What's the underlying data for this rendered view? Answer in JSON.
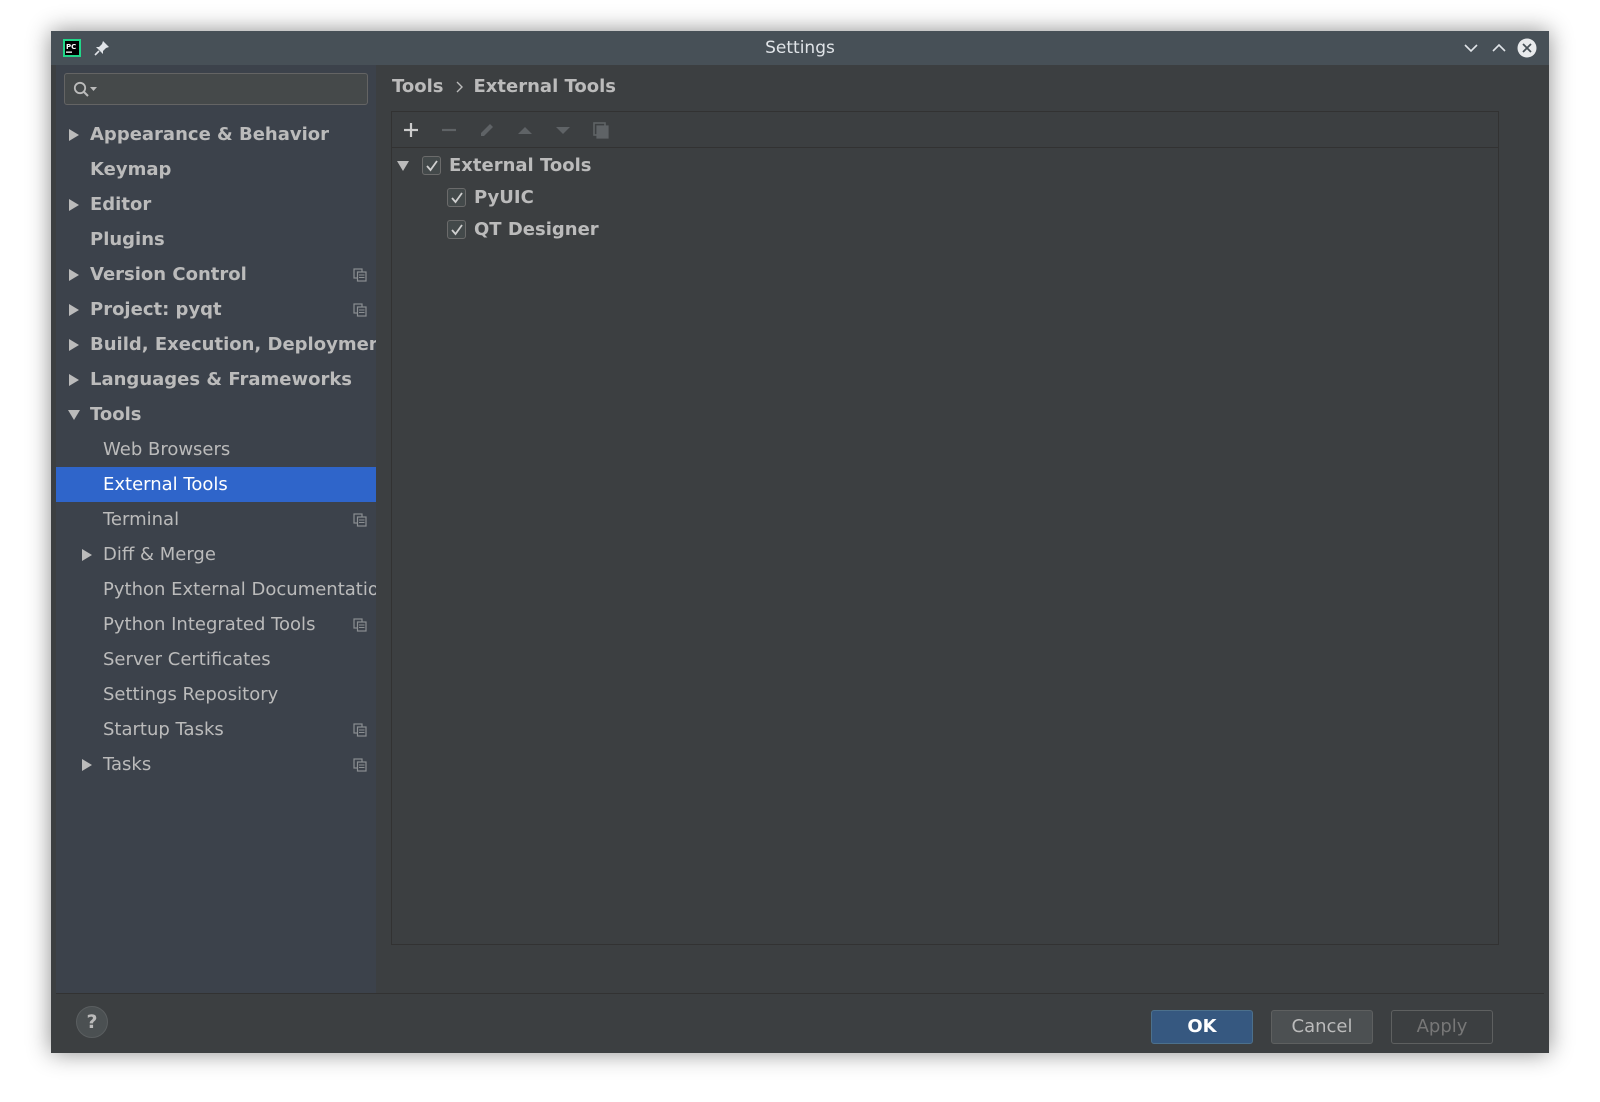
{
  "window": {
    "title": "Settings",
    "app_icon_text": "PC"
  },
  "search": {
    "placeholder": "",
    "value": ""
  },
  "sidebar": {
    "items": [
      {
        "label": "Appearance & Behavior",
        "level": 0,
        "bold": true,
        "arrow": "right",
        "copy_icon": false
      },
      {
        "label": "Keymap",
        "level": 0,
        "bold": true,
        "arrow": "none",
        "copy_icon": false
      },
      {
        "label": "Editor",
        "level": 0,
        "bold": true,
        "arrow": "right",
        "copy_icon": false
      },
      {
        "label": "Plugins",
        "level": 0,
        "bold": true,
        "arrow": "none",
        "copy_icon": false
      },
      {
        "label": "Version Control",
        "level": 0,
        "bold": true,
        "arrow": "right",
        "copy_icon": true
      },
      {
        "label": "Project: pyqt",
        "level": 0,
        "bold": true,
        "arrow": "right",
        "copy_icon": true
      },
      {
        "label": "Build, Execution, Deployment",
        "level": 0,
        "bold": true,
        "arrow": "right",
        "copy_icon": false
      },
      {
        "label": "Languages & Frameworks",
        "level": 0,
        "bold": true,
        "arrow": "right",
        "copy_icon": false
      },
      {
        "label": "Tools",
        "level": 0,
        "bold": true,
        "arrow": "down",
        "copy_icon": false
      },
      {
        "label": "Web Browsers",
        "level": 1,
        "bold": false,
        "arrow": "none",
        "copy_icon": false
      },
      {
        "label": "External Tools",
        "level": 1,
        "bold": false,
        "arrow": "none",
        "copy_icon": false,
        "selected": true
      },
      {
        "label": "Terminal",
        "level": 1,
        "bold": false,
        "arrow": "none",
        "copy_icon": true
      },
      {
        "label": "Diff & Merge",
        "level": 1,
        "bold": false,
        "arrow": "right",
        "copy_icon": false
      },
      {
        "label": "Python External Documentation",
        "level": 1,
        "bold": false,
        "arrow": "none",
        "copy_icon": false
      },
      {
        "label": "Python Integrated Tools",
        "level": 1,
        "bold": false,
        "arrow": "none",
        "copy_icon": true
      },
      {
        "label": "Server Certificates",
        "level": 1,
        "bold": false,
        "arrow": "none",
        "copy_icon": false
      },
      {
        "label": "Settings Repository",
        "level": 1,
        "bold": false,
        "arrow": "none",
        "copy_icon": false
      },
      {
        "label": "Startup Tasks",
        "level": 1,
        "bold": false,
        "arrow": "none",
        "copy_icon": true
      },
      {
        "label": "Tasks",
        "level": 1,
        "bold": false,
        "arrow": "right",
        "copy_icon": true
      }
    ]
  },
  "breadcrumb": {
    "parent": "Tools",
    "current": "External Tools"
  },
  "toolbar": {
    "tools": [
      {
        "icon": "add-icon",
        "enabled": true
      },
      {
        "icon": "remove-icon",
        "enabled": false
      },
      {
        "icon": "edit-icon",
        "enabled": false
      },
      {
        "icon": "move-up-icon",
        "enabled": false
      },
      {
        "icon": "move-down-icon",
        "enabled": false
      },
      {
        "icon": "copy-icon",
        "enabled": false
      }
    ]
  },
  "tools_tree": {
    "group": {
      "label": "External Tools",
      "checked": true,
      "expanded": true
    },
    "children": [
      {
        "label": "PyUIC",
        "checked": true
      },
      {
        "label": "QT Designer",
        "checked": true
      }
    ]
  },
  "footer": {
    "help_label": "?",
    "ok_label": "OK",
    "cancel_label": "Cancel",
    "apply_label": "Apply"
  },
  "colors": {
    "selection": "#2f65ca",
    "ok_button": "#365880",
    "background": "#3c3f41",
    "sidebar_background": "#3c424b"
  }
}
